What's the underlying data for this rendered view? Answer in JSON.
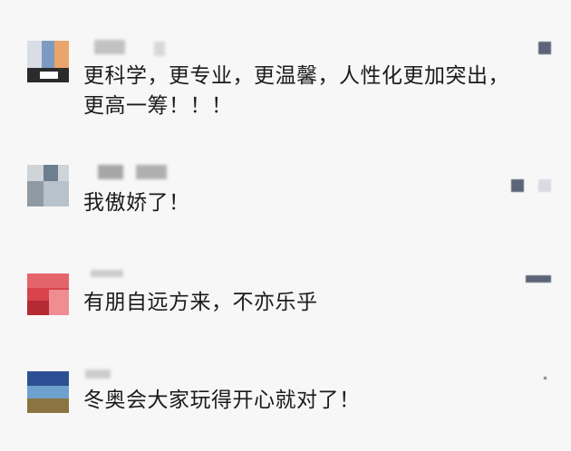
{
  "comments": [
    {
      "text_line1": "更科学，更专业，更温馨，人性化更加突出，",
      "text_line2": "更高一筹！！！",
      "avatar": "blurred-avatar-1"
    },
    {
      "text_line1": "我傲娇了！",
      "avatar": "blurred-avatar-2"
    },
    {
      "text_line1": "有朋自远方来，不亦乐乎",
      "avatar": "blurred-avatar-3"
    },
    {
      "text_line1": "冬奥会大家玩得开心就对了！",
      "avatar": "blurred-avatar-4"
    }
  ],
  "icons": {
    "like": "like-icon"
  }
}
